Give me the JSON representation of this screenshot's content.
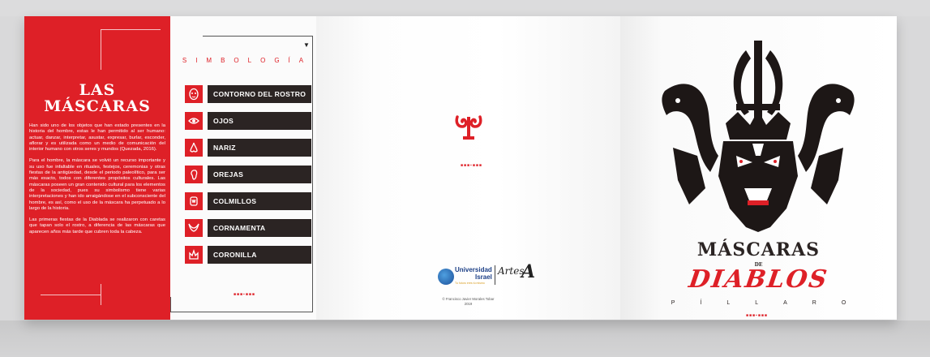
{
  "panel_left": {
    "title_line1": "LAS",
    "title_line2": "MÁSCARAS",
    "paragraphs": [
      "Han sido uno de los objetos que han estado presentes en la historia del hombre, estas le han permitido al ser humano: actuar, danzar, interpretar, asustar, expresar, burlar, esconder, aflorar y es utilizada como un medio de comunicación del interior humano con otros seres y mundos (Quezada, 2016).",
      "Para el hombre, la máscara se volvió un recurso importante y su uso fue infaltable en rituales, festejos, ceremonias y otras fiestas de la antigüedad, desde el periodo paleolítico, para ser más exacto, todos con diferentes propósitos culturales. Las máscaras poseen un gran contenido cultural para los elementos de la sociedad, pues su simbolismo tiene varias interpretaciones y han ido arraigándose en el subconsciente del hombre, es así, como el uso de la máscara ha perpetuado a lo largo de la historia.",
      "Las primeras fiestas de la Diablada se realizaron con caretas que tapan solo el rostro, a diferencia de las máscaras que aparecen años más tarde que cubren toda la cabeza."
    ]
  },
  "simbologia": {
    "heading": "SIMBOLOGÍA",
    "items": [
      {
        "label": "CONTORNO DEL ROSTRO",
        "icon": "face-outline-icon"
      },
      {
        "label": "OJOS",
        "icon": "eye-icon"
      },
      {
        "label": "NARIZ",
        "icon": "nose-icon"
      },
      {
        "label": "OREJAS",
        "icon": "ear-icon"
      },
      {
        "label": "COLMILLOS",
        "icon": "fang-icon"
      },
      {
        "label": "CORNAMENTA",
        "icon": "horns-icon"
      },
      {
        "label": "CORONILLA",
        "icon": "crown-icon"
      }
    ]
  },
  "center_panel": {
    "logo_univ_line1": "Universidad",
    "logo_univ_line2": "Israel",
    "logo_univ_tagline": "Tu futuro eres tú mismo",
    "logo_artes": "Artes",
    "credit_line1": "© Francisco Javier Morales Tobar",
    "credit_line2": "2019"
  },
  "cover": {
    "title_line1": "MÁSCARAS",
    "title_line2": "DE",
    "title_line3": "DIABLOS",
    "subtitle": "PÍLLARO"
  },
  "colors": {
    "accent": "#de2027",
    "dark": "#2b2423"
  }
}
